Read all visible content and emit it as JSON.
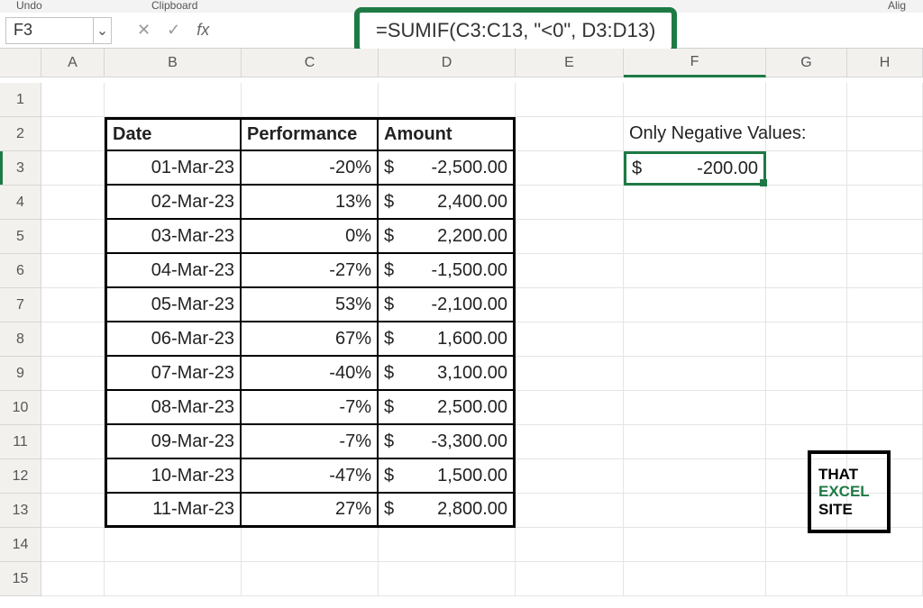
{
  "ribbon": {
    "undo": "Undo",
    "clipboard": "Clipboard",
    "align": "Alig"
  },
  "namebox": {
    "value": "F3"
  },
  "formula": {
    "text": "=SUMIF(C3:C13, \"<0\", D3:D13)"
  },
  "columns": [
    "A",
    "B",
    "C",
    "D",
    "E",
    "F",
    "G",
    "H"
  ],
  "rows": [
    "1",
    "2",
    "3",
    "4",
    "5",
    "6",
    "7",
    "8",
    "9",
    "10",
    "11",
    "12",
    "13",
    "14",
    "15"
  ],
  "table": {
    "headers": {
      "date": "Date",
      "performance": "Performance",
      "amount": "Amount"
    },
    "data": [
      {
        "date": "01-Mar-23",
        "perf": "-20%",
        "amt": "-2,500.00"
      },
      {
        "date": "02-Mar-23",
        "perf": "13%",
        "amt": "2,400.00"
      },
      {
        "date": "03-Mar-23",
        "perf": "0%",
        "amt": "2,200.00"
      },
      {
        "date": "04-Mar-23",
        "perf": "-27%",
        "amt": "-1,500.00"
      },
      {
        "date": "05-Mar-23",
        "perf": "53%",
        "amt": "-2,100.00"
      },
      {
        "date": "06-Mar-23",
        "perf": "67%",
        "amt": "1,600.00"
      },
      {
        "date": "07-Mar-23",
        "perf": "-40%",
        "amt": "3,100.00"
      },
      {
        "date": "08-Mar-23",
        "perf": "-7%",
        "amt": "2,500.00"
      },
      {
        "date": "09-Mar-23",
        "perf": "-7%",
        "amt": "-3,300.00"
      },
      {
        "date": "10-Mar-23",
        "perf": "-47%",
        "amt": "1,500.00"
      },
      {
        "date": "11-Mar-23",
        "perf": "27%",
        "amt": "2,800.00"
      }
    ]
  },
  "side": {
    "label": "Only Negative Values:",
    "result_sym": "$",
    "result_val": "-200.00"
  },
  "logo": {
    "l1": "THAT",
    "l2": "EXCEL",
    "l3": "SITE"
  }
}
